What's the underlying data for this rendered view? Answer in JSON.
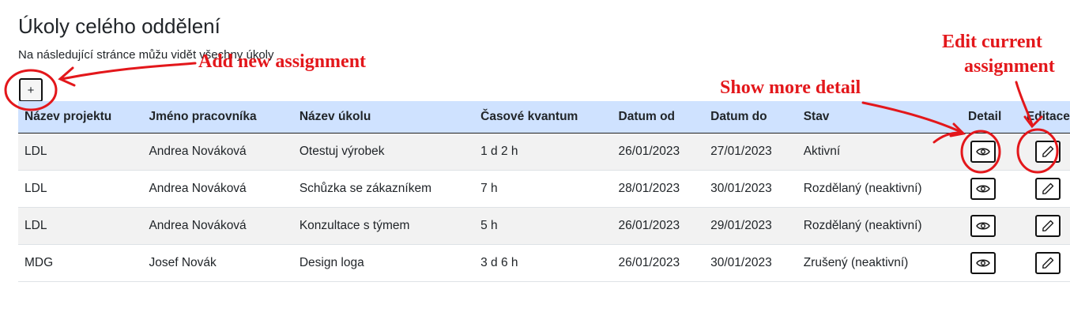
{
  "page": {
    "title": "Úkoly celého oddělení",
    "subtitle": "Na následující stránce můžu vidět všechny úkoly"
  },
  "toolbar": {
    "add_label": "+"
  },
  "table": {
    "headers": [
      "Název projektu",
      "Jméno pracovníka",
      "Název úkolu",
      "Časové kvantum",
      "Datum od",
      "Datum do",
      "Stav",
      "Detail",
      "Editace"
    ],
    "rows": [
      [
        "LDL",
        "Andrea Nováková",
        "Otestuj výrobek",
        "1 d 2 h",
        "26/01/2023",
        "27/01/2023",
        "Aktivní"
      ],
      [
        "LDL",
        "Andrea Nováková",
        "Schůzka se zákazníkem",
        "7 h",
        "28/01/2023",
        "30/01/2023",
        "Rozdělaný (neaktivní)"
      ],
      [
        "LDL",
        "Andrea Nováková",
        "Konzultace s týmem",
        "5 h",
        "26/01/2023",
        "29/01/2023",
        "Rozdělaný (neaktivní)"
      ],
      [
        "MDG",
        "Josef Novák",
        "Design loga",
        "3 d 6 h",
        "26/01/2023",
        "30/01/2023",
        "Zrušený (neaktivní)"
      ]
    ],
    "detail_icon": "eye-icon",
    "edit_icon": "pencil-icon"
  },
  "annotations": {
    "add": "Add new assignment",
    "detail": "Show more detail",
    "edit_line1": "Edit current",
    "edit_line2": "assignment",
    "color": "#e3171b"
  },
  "colors": {
    "header_bg": "#cfe2ff",
    "stripe_bg": "#f2f2f2"
  }
}
